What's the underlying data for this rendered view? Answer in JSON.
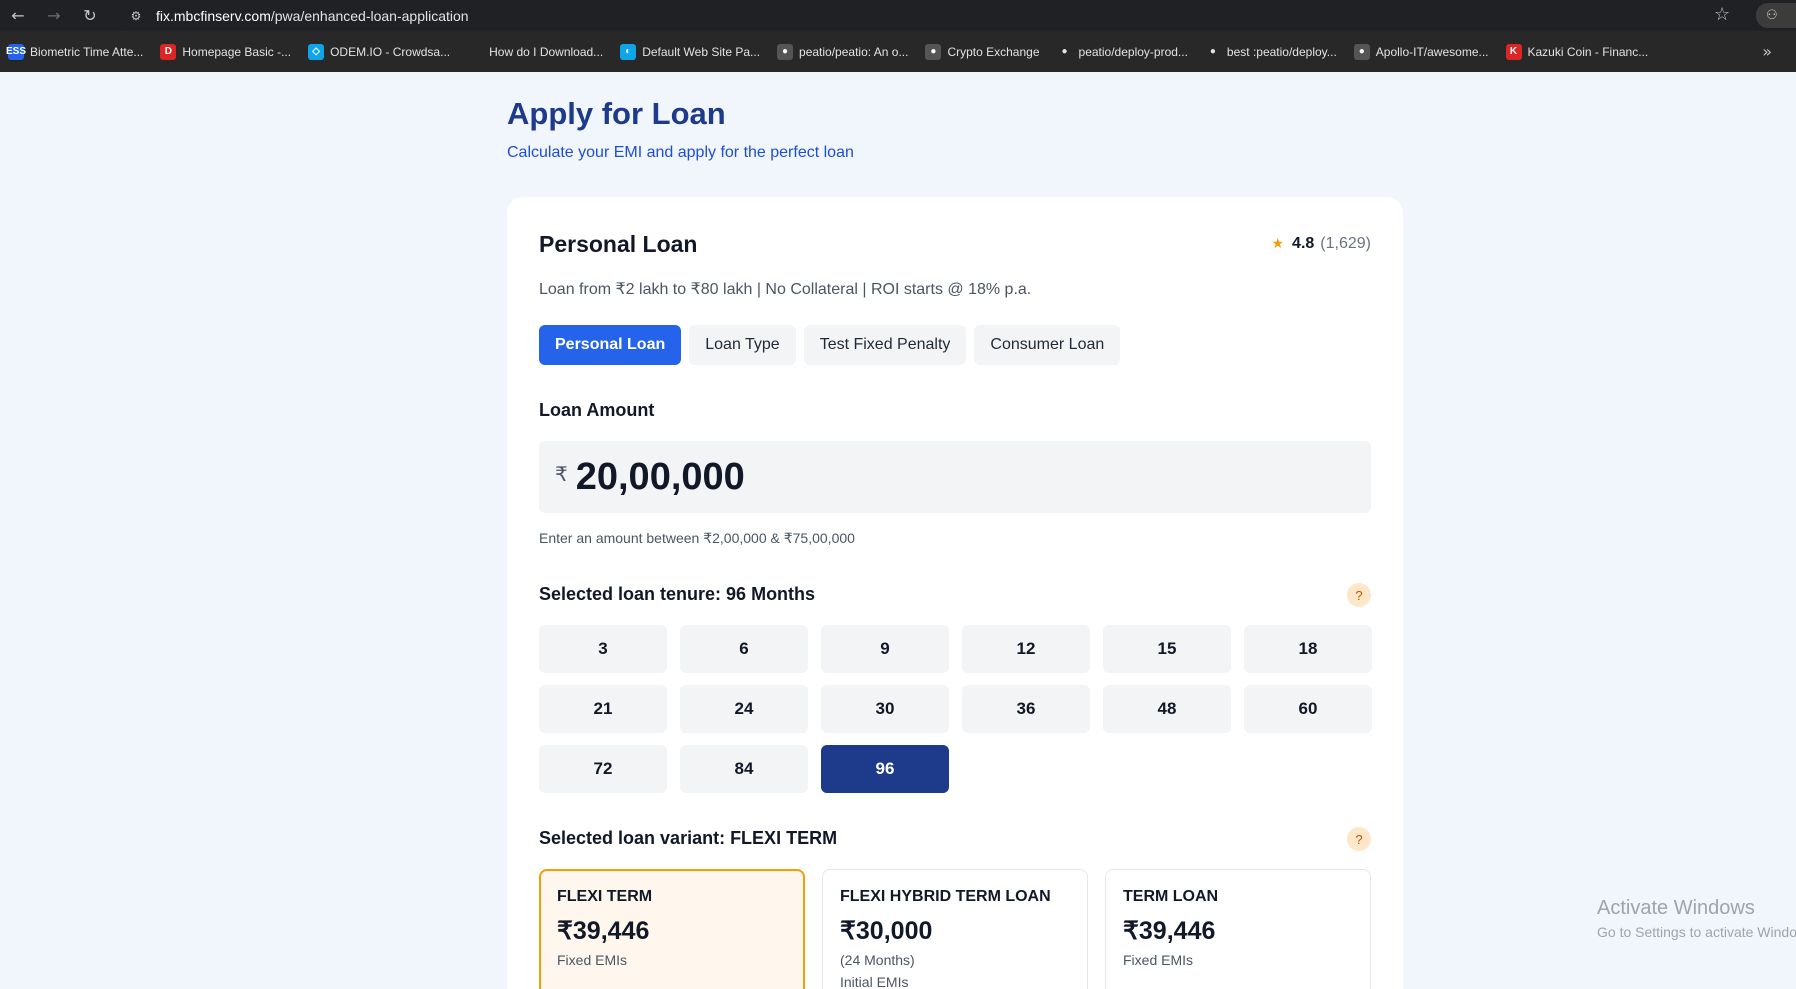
{
  "browser": {
    "url_host": "fix.mbcfinserv.com",
    "url_path": "/pwa/enhanced-loan-application",
    "bookmarks": [
      {
        "label": "Biometric Time Atte...",
        "icon_text": "ESS",
        "icon_color": "#2563eb"
      },
      {
        "label": "Homepage Basic -...",
        "icon_text": "D",
        "icon_color": "#dc2626"
      },
      {
        "label": "ODEM.IO - Crowdsa...",
        "icon_text": "◇",
        "icon_color": "#0ea5e9"
      },
      {
        "label": "How do I Download...",
        "icon_text": "",
        "icon_color": "#282828"
      },
      {
        "label": "Default Web Site Pa...",
        "icon_text": "◐",
        "icon_color": "#0ea5e9"
      },
      {
        "label": "peatio/peatio: An o...",
        "icon_text": "●",
        "icon_color": "#555555"
      },
      {
        "label": "Crypto Exchange",
        "icon_text": "●",
        "icon_color": "#555555"
      },
      {
        "label": "peatio/deploy-prod...",
        "icon_text": "●",
        "icon_color": "#e3e3e3"
      },
      {
        "label": "best :peatio/deploy...",
        "icon_text": "●",
        "icon_color": "#e3e3e3"
      },
      {
        "label": "Apollo-IT/awesome...",
        "icon_text": "●",
        "icon_color": "#555555"
      },
      {
        "label": "Kazuki Coin - Financ...",
        "icon_text": "K",
        "icon_color": "#dc2626"
      }
    ]
  },
  "page": {
    "title": "Apply for Loan",
    "subtitle": "Calculate your EMI and apply for the perfect loan"
  },
  "loan": {
    "name": "Personal Loan",
    "rating": "4.8",
    "reviews": "(1,629)",
    "description": "Loan from ₹2 lakh to ₹80 lakh | No Collateral | ROI starts @ 18% p.a.",
    "tabs": [
      "Personal Loan",
      "Loan Type",
      "Test Fixed Penalty",
      "Consumer Loan"
    ],
    "active_tab": 0
  },
  "amount": {
    "label": "Loan Amount",
    "currency": "₹",
    "value": "20,00,000",
    "hint": "Enter an amount between ₹2,00,000 & ₹75,00,000"
  },
  "tenure": {
    "label": "Selected loan tenure: 96 Months",
    "help": "?",
    "options": [
      "3",
      "6",
      "9",
      "12",
      "15",
      "18",
      "21",
      "24",
      "30",
      "36",
      "48",
      "60",
      "72",
      "84",
      "96"
    ],
    "selected": "96"
  },
  "variant": {
    "label": "Selected loan variant: FLEXI TERM",
    "help": "?",
    "options": [
      {
        "name": "FLEXI TERM",
        "amount": "₹39,446",
        "note": "Fixed EMIs",
        "note2": ""
      },
      {
        "name": "FLEXI HYBRID TERM LOAN",
        "amount": "₹30,000",
        "note": "(24 Months)",
        "note2": "Initial EMIs"
      },
      {
        "name": "TERM LOAN",
        "amount": "₹39,446",
        "note": "Fixed EMIs",
        "note2": ""
      }
    ],
    "selected": 0
  },
  "watermark": {
    "line1": "Activate Windows",
    "line2": "Go to Settings to activate Windows."
  },
  "colors": {
    "primary": "#2563eb",
    "navy": "#1e3a8a",
    "accent": "#f59e0b"
  }
}
